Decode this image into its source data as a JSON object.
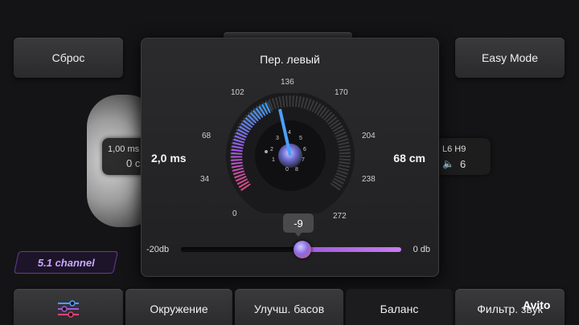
{
  "header": {
    "reset_label": "Сброс",
    "easy_mode_label": "Easy Mode"
  },
  "left_card": {
    "delay": "1,00 ms",
    "value": "0 c"
  },
  "right_card": {
    "speaker": "L6 H9",
    "volume": "6"
  },
  "channel_badge": "5.1 channel",
  "dialog": {
    "title": "Пер. левый",
    "delay_value": "2,0 ms",
    "distance_value": "68 cm",
    "gauge_ticks": [
      "0",
      "34",
      "68",
      "102",
      "136",
      "170",
      "204",
      "238",
      "272"
    ],
    "inner_ticks": [
      "0",
      "1",
      "2",
      "3",
      "4",
      "5",
      "6",
      "7",
      "8"
    ],
    "slider_min_label": "-20db",
    "slider_max_label": "0 db",
    "slider_value": "-9",
    "slider_fraction": 0.55
  },
  "tabs": {
    "equalizer_icon": "sliders-icon",
    "environment_label": "Окружение",
    "bass_label": "Улучш. басов",
    "balance_label": "Баланс",
    "filter_label": "Фильтр. звук"
  },
  "watermark": "Avito",
  "colors": {
    "accent_purple": "#a05ad8",
    "accent_blue": "#4aa0ff",
    "badge_text": "#c8a8ff"
  }
}
